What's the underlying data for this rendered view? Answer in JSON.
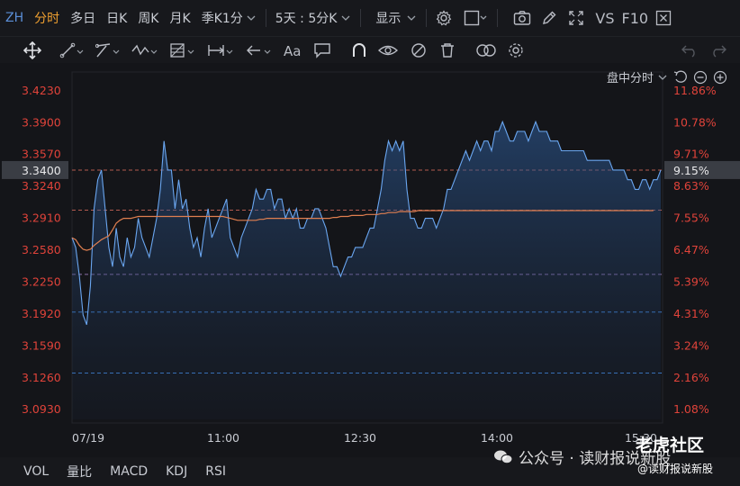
{
  "toolbar": {
    "exchange": "ZH",
    "tabs": [
      "分时",
      "多日",
      "日K",
      "周K",
      "月K",
      "季K"
    ],
    "interval": "1分",
    "multi_day": "5天 : 5分K",
    "display": "显示",
    "vs": "VS",
    "f10": "F10"
  },
  "corner": {
    "mode": "盘中分时"
  },
  "bottom": {
    "indicators": [
      "VOL",
      "量比",
      "MACD",
      "KDJ",
      "RSI"
    ]
  },
  "watermark": {
    "line1": "公众号 · 读财报说新股",
    "brand": "老虎社区",
    "handle": "@读财报说新股"
  },
  "colors": {
    "price_line": "#6aa6f0",
    "avg_line": "#e07f50",
    "price_axis": "#e0433a",
    "pct_axis": "#e0433a",
    "current_price_bg": "#3a3d44",
    "dashed_red": "#b35a4f",
    "dashed_blue": "#3f7fd0",
    "dashed_purple": "#8a6fa8"
  },
  "chart_data": {
    "type": "line",
    "x_ticks": [
      "07/19",
      "11:00",
      "12:30",
      "14:00",
      "15:30"
    ],
    "y_left_ticks": [
      "3.4230",
      "3.3900",
      "3.3570",
      "3.3240",
      "3.2910",
      "3.2580",
      "3.2250",
      "3.1920",
      "3.1590",
      "3.1260",
      "3.0930"
    ],
    "y_right_ticks": [
      "11.86%",
      "10.78%",
      "9.71%",
      "8.63%",
      "7.55%",
      "6.47%",
      "5.39%",
      "4.31%",
      "3.24%",
      "2.16%",
      "1.08%"
    ],
    "current_price": "3.3400",
    "current_pct": "9.15%",
    "ylim": [
      3.082,
      3.434
    ],
    "ref_lines": [
      3.34,
      3.2985,
      3.232,
      3.193,
      3.13
    ],
    "series": [
      {
        "values": [
          3.27,
          3.26,
          3.23,
          3.19,
          3.18,
          3.22,
          3.3,
          3.33,
          3.34,
          3.3,
          3.26,
          3.24,
          3.28,
          3.25,
          3.24,
          3.27,
          3.25,
          3.26,
          3.29,
          3.27,
          3.26,
          3.25,
          3.27,
          3.29,
          3.32,
          3.37,
          3.34,
          3.34,
          3.3,
          3.33,
          3.3,
          3.31,
          3.28,
          3.26,
          3.27,
          3.25,
          3.28,
          3.3,
          3.27,
          3.28,
          3.29,
          3.3,
          3.31,
          3.27,
          3.26,
          3.25,
          3.27,
          3.28,
          3.29,
          3.3,
          3.32,
          3.31,
          3.31,
          3.32,
          3.32,
          3.3,
          3.31,
          3.31,
          3.29,
          3.3,
          3.29,
          3.3,
          3.28,
          3.28,
          3.29,
          3.29,
          3.3,
          3.3,
          3.29,
          3.28,
          3.26,
          3.24,
          3.24,
          3.23,
          3.24,
          3.25,
          3.25,
          3.26,
          3.26,
          3.26,
          3.27,
          3.28,
          3.28,
          3.3,
          3.32,
          3.35,
          3.37,
          3.36,
          3.37,
          3.36,
          3.37,
          3.32,
          3.29,
          3.29,
          3.28,
          3.28,
          3.29,
          3.29,
          3.29,
          3.28,
          3.29,
          3.3,
          3.32,
          3.32,
          3.33,
          3.34,
          3.35,
          3.36,
          3.35,
          3.36,
          3.37,
          3.36,
          3.37,
          3.37,
          3.36,
          3.38,
          3.38,
          3.39,
          3.38,
          3.37,
          3.37,
          3.38,
          3.38,
          3.38,
          3.37,
          3.38,
          3.39,
          3.38,
          3.38,
          3.38,
          3.37,
          3.37,
          3.37,
          3.36,
          3.36,
          3.36,
          3.36,
          3.36,
          3.36,
          3.36,
          3.35,
          3.35,
          3.35,
          3.35,
          3.35,
          3.35,
          3.35,
          3.34,
          3.34,
          3.34,
          3.34,
          3.33,
          3.33,
          3.32,
          3.32,
          3.33,
          3.33,
          3.32,
          3.33,
          3.33,
          3.34
        ]
      },
      {
        "values": [
          3.27,
          3.268,
          3.262,
          3.258,
          3.257,
          3.258,
          3.262,
          3.265,
          3.268,
          3.27,
          3.272,
          3.278,
          3.285,
          3.288,
          3.29,
          3.29,
          3.29,
          3.291,
          3.292,
          3.292,
          3.292,
          3.292,
          3.292,
          3.292,
          3.292,
          3.292,
          3.292,
          3.292,
          3.292,
          3.292,
          3.292,
          3.292,
          3.292,
          3.292,
          3.292,
          3.292,
          3.292,
          3.292,
          3.292,
          3.292,
          3.292,
          3.292,
          3.291,
          3.29,
          3.289,
          3.288,
          3.288,
          3.288,
          3.288,
          3.288,
          3.288,
          3.289,
          3.289,
          3.29,
          3.29,
          3.29,
          3.29,
          3.29,
          3.29,
          3.29,
          3.29,
          3.29,
          3.29,
          3.29,
          3.29,
          3.29,
          3.29,
          3.29,
          3.29,
          3.29,
          3.29,
          3.291,
          3.291,
          3.292,
          3.292,
          3.292,
          3.293,
          3.293,
          3.293,
          3.293,
          3.294,
          3.294,
          3.294,
          3.294,
          3.295,
          3.295,
          3.296,
          3.296,
          3.296,
          3.297,
          3.297,
          3.297,
          3.297,
          3.297,
          3.298,
          3.298,
          3.298,
          3.298,
          3.298,
          3.298,
          3.298,
          3.298,
          3.298,
          3.298,
          3.298,
          3.298,
          3.298,
          3.298,
          3.298,
          3.298,
          3.298,
          3.298,
          3.298,
          3.298,
          3.298,
          3.298,
          3.298,
          3.298,
          3.298,
          3.298,
          3.298,
          3.298,
          3.298,
          3.298,
          3.298,
          3.298,
          3.298,
          3.298,
          3.298,
          3.298,
          3.298,
          3.298,
          3.298,
          3.298,
          3.298,
          3.298,
          3.298,
          3.298,
          3.298,
          3.298,
          3.298,
          3.298,
          3.298,
          3.298,
          3.298,
          3.298,
          3.298,
          3.298,
          3.298,
          3.298,
          3.298,
          3.298,
          3.298,
          3.298,
          3.298,
          3.298,
          3.298,
          3.298,
          3.298
        ]
      }
    ]
  }
}
